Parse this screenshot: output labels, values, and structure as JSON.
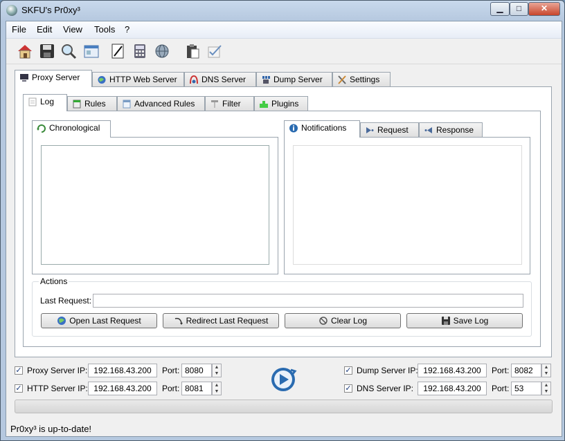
{
  "window": {
    "title": "SKFU's Pr0xy³",
    "minimize": "▁",
    "maximize": "□",
    "close": "✕"
  },
  "menu": {
    "items": [
      "File",
      "Edit",
      "View",
      "Tools",
      "?"
    ]
  },
  "toolbar": {
    "icons": [
      "home-icon",
      "save-icon",
      "search-icon",
      "window-icon",
      "notepad-icon",
      "calculator-icon",
      "globe-icon",
      "clipboard-icon",
      "checklist-icon"
    ]
  },
  "main_tabs": [
    "Proxy Server",
    "HTTP Web Server",
    "DNS Server",
    "Dump Server",
    "Settings"
  ],
  "sub_tabs": [
    "Log",
    "Rules",
    "Advanced Rules",
    "Filter",
    "Plugins"
  ],
  "log": {
    "left_tab": "Chronological",
    "right_tabs": [
      "Notifications",
      "Request",
      "Response"
    ]
  },
  "actions": {
    "group_title": "Actions",
    "last_request_label": "Last Request:",
    "last_request_value": "",
    "buttons": [
      "Open Last Request",
      "Redirect Last Request",
      "Clear Log",
      "Save Log"
    ]
  },
  "servers": {
    "proxy": {
      "label": "Proxy Server IP:",
      "ip": "192.168.43.200",
      "port_label": "Port:",
      "port": "8080",
      "checked": true
    },
    "http": {
      "label": "HTTP Server IP:",
      "ip": "192.168.43.200",
      "port_label": "Port:",
      "port": "8081",
      "checked": true
    },
    "dump": {
      "label": "Dump Server IP:",
      "ip": "192.168.43.200",
      "port_label": "Port:",
      "port": "8082",
      "checked": true
    },
    "dns": {
      "label": "DNS Server IP:",
      "ip": "192.168.43.200",
      "port_label": "Port:",
      "port": "53",
      "checked": true
    }
  },
  "status": {
    "text": "Pr0xy³ is up-to-date!",
    "progress": 0
  },
  "colors": {
    "accent": "#2a6bb0",
    "tab_border": "#9aa4ae"
  }
}
